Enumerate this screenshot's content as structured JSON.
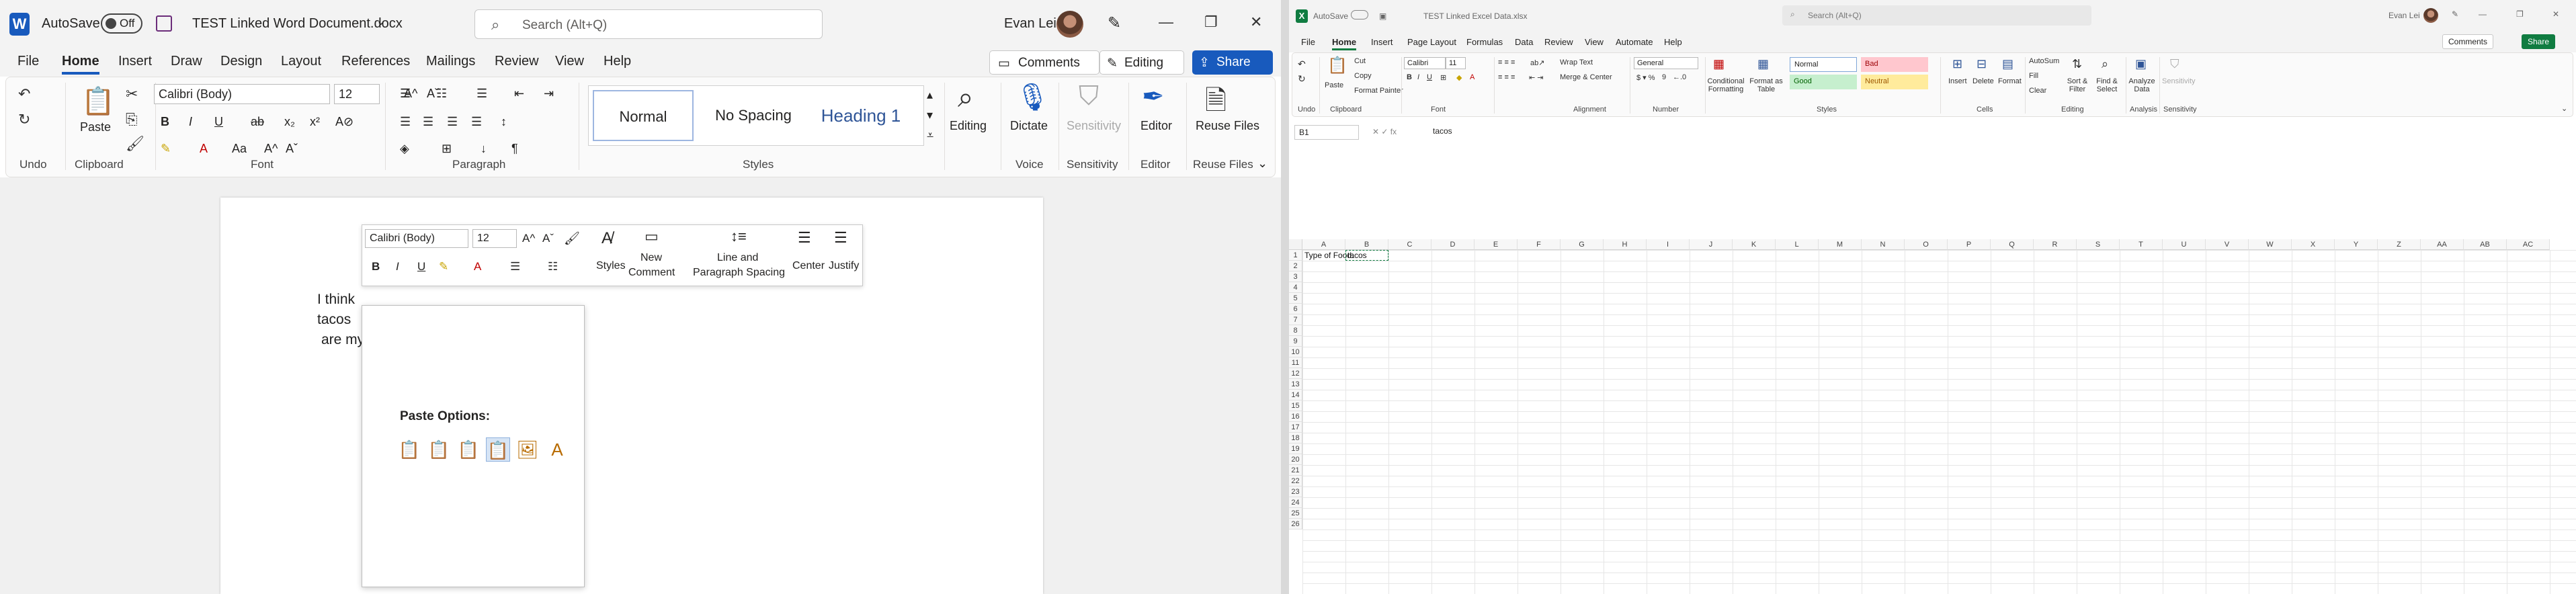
{
  "word": {
    "app_letter": "W",
    "autosave_label": "AutoSave",
    "autosave_state": "Off",
    "doc_title": "TEST Linked Word Document.docx",
    "search_placeholder": "Search (Alt+Q)",
    "user_name": "Evan Lei",
    "tabs": [
      "File",
      "Home",
      "Insert",
      "Draw",
      "Design",
      "Layout",
      "References",
      "Mailings",
      "Review",
      "View",
      "Help"
    ],
    "active_tab": "Home",
    "comments_btn": "Comments",
    "editing_btn": "Editing",
    "share_btn": "Share",
    "ribbon": {
      "undo_label": "Undo",
      "clipboard_label": "Clipboard",
      "paste_label": "Paste",
      "font_label": "Font",
      "font_name": "Calibri (Body)",
      "font_size": "12",
      "paragraph_label": "Paragraph",
      "styles_label": "Styles",
      "style_normal": "Normal",
      "style_nospacing": "No Spacing",
      "style_heading1": "Heading 1",
      "editing_label": "Editing",
      "dictate_label": "Dictate",
      "voice_label": "Voice",
      "sensitivity_label": "Sensitivity",
      "editor_label": "Editor",
      "reuse_files_label": "Reuse Files"
    },
    "document_lines": [
      "I think",
      "tacos",
      "are my favorite food."
    ],
    "mini_toolbar": {
      "font_name": "Calibri (Body)",
      "font_size": "12",
      "styles": "Styles",
      "new_comment_1": "New",
      "new_comment_2": "Comment",
      "line_spacing_1": "Line and",
      "line_spacing_2": "Paragraph Spacing",
      "center": "Center",
      "justify": "Justify"
    },
    "paste_options_title": "Paste Options:"
  },
  "excel": {
    "app_letter": "X",
    "autosave_label": "AutoSave",
    "doc_title": "TEST Linked Excel Data.xlsx",
    "search_placeholder": "Search (Alt+Q)",
    "user_name": "Evan Lei",
    "tabs": [
      "File",
      "Home",
      "Insert",
      "Page Layout",
      "Formulas",
      "Data",
      "Review",
      "View",
      "Automate",
      "Help"
    ],
    "active_tab": "Home",
    "comments_btn": "Comments",
    "share_btn": "Share",
    "ribbon": {
      "paste": "Paste",
      "cut": "Cut",
      "copy": "Copy",
      "format_painter": "Format Painter",
      "clipboard_label": "Clipboard",
      "font_name": "Calibri",
      "font_size": "11",
      "font_label": "Font",
      "wrap_text": "Wrap Text",
      "merge_center": "Merge & Center",
      "alignment_label": "Alignment",
      "number_format": "General",
      "number_label": "Number",
      "conditional_formatting": "Conditional Formatting",
      "format_as_table": "Format as Table",
      "styles_label": "Styles",
      "style_normal": "Normal",
      "style_bad": "Bad",
      "style_good": "Good",
      "style_neutral": "Neutral",
      "insert": "Insert",
      "delete": "Delete",
      "format": "Format",
      "cells_label": "Cells",
      "autosum": "AutoSum",
      "fill": "Fill",
      "clear": "Clear",
      "sort_filter": "Sort & Filter",
      "find_select": "Find & Select",
      "editing_label": "Editing",
      "analyze_data": "Analyze Data",
      "analysis_label": "Analysis",
      "sensitivity": "Sensitivity",
      "sensitivity_label": "Sensitivity",
      "undo_label": "Undo"
    },
    "name_box": "B1",
    "formula_value": "tacos",
    "columns": [
      "A",
      "B",
      "C",
      "D",
      "E",
      "F",
      "G",
      "H",
      "I",
      "J",
      "K",
      "L",
      "M",
      "N",
      "O",
      "P",
      "Q",
      "R",
      "S",
      "T",
      "U",
      "V",
      "W",
      "X",
      "Y",
      "Z",
      "AA",
      "AB",
      "AC"
    ],
    "rows": [
      "1",
      "2",
      "3",
      "4",
      "5",
      "6",
      "7",
      "8",
      "9",
      "10",
      "11",
      "12",
      "13",
      "14",
      "15",
      "16",
      "17",
      "18",
      "19",
      "20",
      "21",
      "22",
      "23",
      "24",
      "25",
      "26"
    ],
    "cell_a1": "Type of Food:",
    "cell_b1": "tacos"
  },
  "colors": {
    "word_blue": "#185abd",
    "excel_green": "#107c41",
    "style_bad_bg": "#ffc7ce",
    "style_good_bg": "#c6efce",
    "style_neutral_bg": "#ffeb9c"
  }
}
